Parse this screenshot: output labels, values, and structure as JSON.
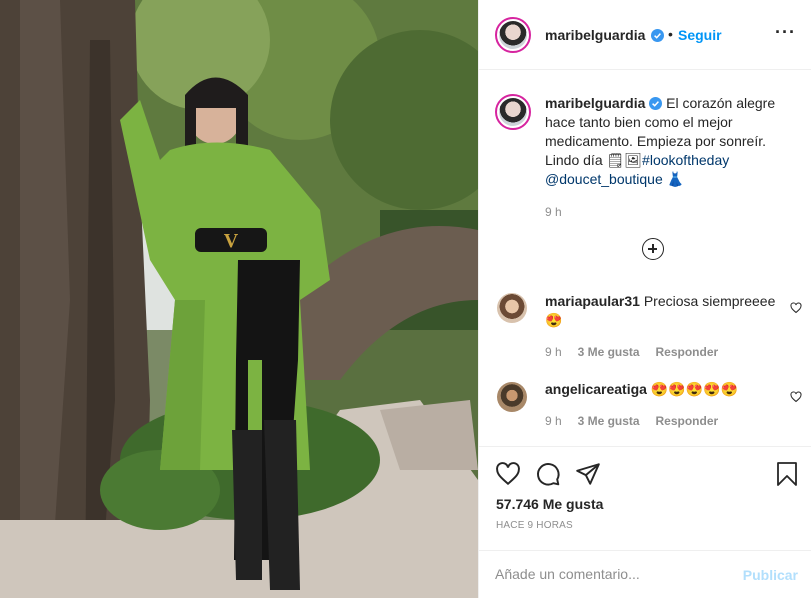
{
  "post": {
    "username": "maribelguardia",
    "follow_label": "Seguir",
    "caption_text": "El corazón alegre hace tanto bien como el mejor medicamento. Empieza por sonreír. Lindo día",
    "caption_emoji": "🗒🖼",
    "hashtag": "#lookoftheday",
    "mention": "@doucet_boutique",
    "mention_emoji": "👗",
    "caption_time": "9 h"
  },
  "comments": [
    {
      "username": "mariapaular31",
      "text": "Preciosa siempreeee 😍",
      "time": "9 h",
      "likes": "3 Me gusta",
      "reply": "Responder"
    },
    {
      "username": "angelicareatiga",
      "text": "😍😍😍😍😍",
      "time": "9 h",
      "likes": "3 Me gusta",
      "reply": "Responder"
    }
  ],
  "stats": {
    "likes": "57.746 Me gusta",
    "posted": "HACE 9 HORAS"
  },
  "composer": {
    "placeholder": "Añade un comentario...",
    "publish_label": "Publicar"
  },
  "colors": {
    "accent": "#0095f6",
    "verified": "#3897f0",
    "publish_disabled": "#b2dffc"
  },
  "icons": [
    "heart-icon",
    "comment-icon",
    "share-icon",
    "bookmark-icon",
    "verified-badge-icon",
    "plus-circle-icon"
  ]
}
